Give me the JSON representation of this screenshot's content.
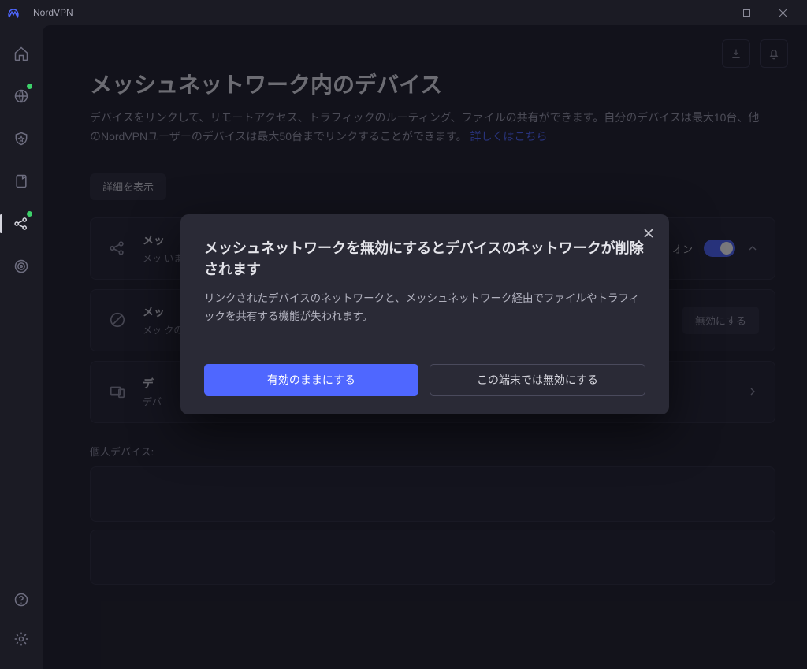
{
  "titlebar": {
    "title": "NordVPN"
  },
  "sidebar": {
    "items": [
      {
        "name": "home-icon"
      },
      {
        "name": "globe-icon",
        "dot": true
      },
      {
        "name": "shield-icon"
      },
      {
        "name": "upload-icon"
      },
      {
        "name": "mesh-icon",
        "active": true,
        "dot": true
      },
      {
        "name": "target-icon"
      }
    ],
    "bottom": [
      {
        "name": "help-icon"
      },
      {
        "name": "gear-icon"
      }
    ]
  },
  "top_actions": {
    "download": "download-icon",
    "bell": "bell-icon"
  },
  "page": {
    "title": "メッシュネットワーク内のデバイス",
    "desc_prefix": "デバイスをリンクして、リモートアクセス、トラフィックのルーティング、ファイルの共有ができます。自分のデバイスは最大10台、他のNordVPNユーザーのデバイスは最大50台までリンクすることができます。",
    "learn_more": "詳しくはこちら",
    "details_btn": "詳細を表示"
  },
  "cards": {
    "c1_title": "メッ",
    "c1_sub": "メッ\nいま",
    "c1_toggle_label": "オン",
    "c2_title": "メッ",
    "c2_sub": "メッ\nクの",
    "c2_btn": "無効にする",
    "c3_title": "デ",
    "c3_sub": "デバ"
  },
  "section": {
    "devices_label": "個人デバイス:"
  },
  "modal": {
    "title": "メッシュネットワークを無効にするとデバイスのネットワークが削除されます",
    "desc": "リンクされたデバイスのネットワークと、メッシュネットワーク経由でファイルやトラフィックを共有する機能が失われます。",
    "btn_primary": "有効のままにする",
    "btn_secondary": "この端末では無効にする"
  }
}
